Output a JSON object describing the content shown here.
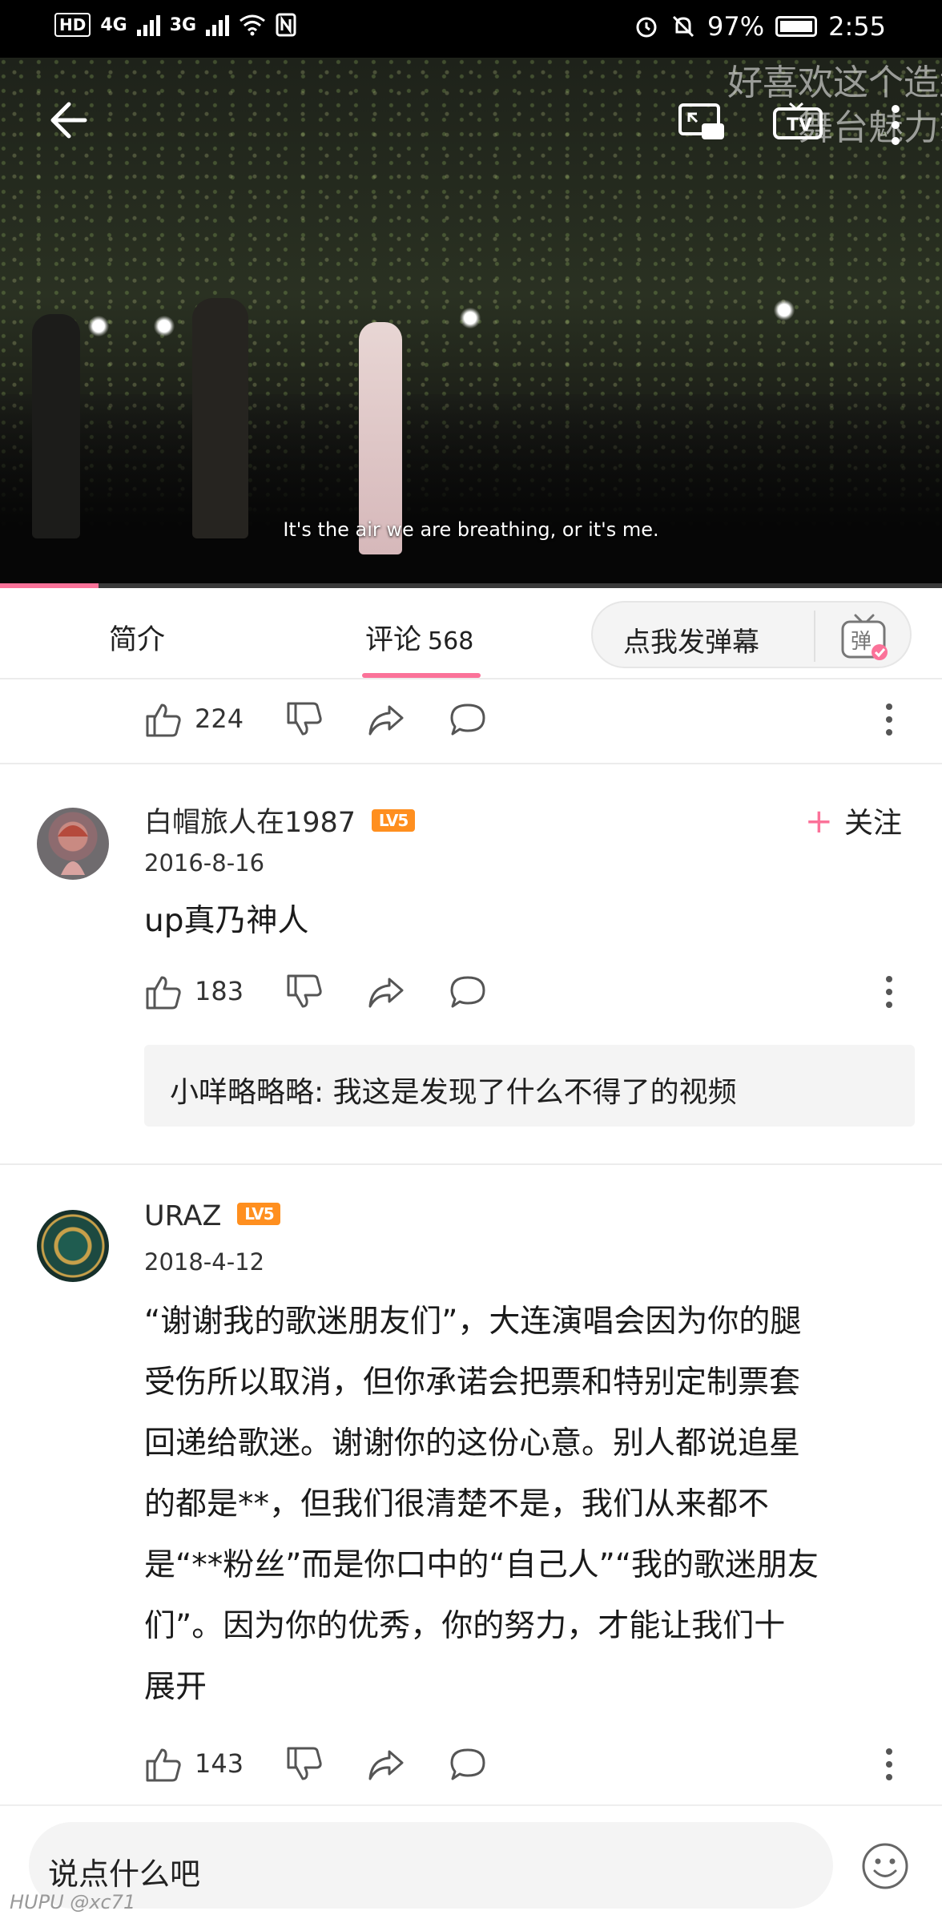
{
  "status_bar": {
    "hd_badge": "HD",
    "net1": "4G",
    "net2": "3G",
    "battery": "97%",
    "time": "2:55"
  },
  "video": {
    "danmaku": [
      "好喜欢这个造型",
      "舞台魅力范"
    ],
    "subtitle": "It's the air we are breathing, or it's me.",
    "progress_fraction": 0.105
  },
  "tabs": {
    "intro": "简介",
    "comments": "评论",
    "comments_count": "568",
    "danmu_button": "点我发弹幕",
    "danmu_icon_text": "弹"
  },
  "prev_comment": {
    "likes": "224"
  },
  "comments": [
    {
      "username": "白帽旅人在1987",
      "level": "LV5",
      "date": "2016-8-16",
      "follow_label": "关注",
      "text": "up真乃神人",
      "likes": "183",
      "reply_preview": "小咩略略略: 我这是发现了什么不得了的视频"
    },
    {
      "username": "URAZ",
      "level": "LV5",
      "date": "2018-4-12",
      "text_lines": [
        "“谢谢我的歌迷朋友们”，大连演唱会因为你的腿",
        "受伤所以取消，但你承诺会把票和特别定制票套",
        "回递给歌迷。谢谢你的这份心意。别人都说追星",
        "的都是**，但我们很清楚不是，我们从来都不",
        "是“**粉丝”而是你口中的“自己人”“我的歌迷朋友",
        "们”。因为你的优秀，你的努力，才能让我们十",
        "展开"
      ],
      "likes": "143"
    }
  ],
  "bottom": {
    "input_placeholder": "说点什么吧",
    "watermark": "HUPU @xc71"
  },
  "colors": {
    "accent_pink": "#fb7299",
    "level_orange": "#ff8f1f"
  }
}
